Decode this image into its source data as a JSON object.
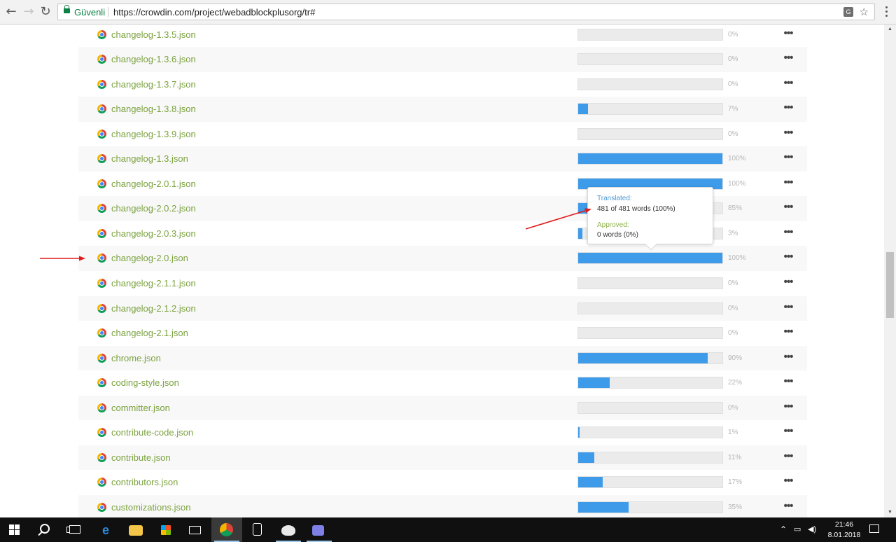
{
  "browser": {
    "secure_label": "Güvenli",
    "url": "https://crowdin.com/project/webadblockplusorg/tr#"
  },
  "files": [
    {
      "name": "changelog-1.3.5.json",
      "percent": 0,
      "percent_label": "0%"
    },
    {
      "name": "changelog-1.3.6.json",
      "percent": 0,
      "percent_label": "0%"
    },
    {
      "name": "changelog-1.3.7.json",
      "percent": 0,
      "percent_label": "0%"
    },
    {
      "name": "changelog-1.3.8.json",
      "percent": 7,
      "percent_label": "7%"
    },
    {
      "name": "changelog-1.3.9.json",
      "percent": 0,
      "percent_label": "0%"
    },
    {
      "name": "changelog-1.3.json",
      "percent": 100,
      "percent_label": "100%"
    },
    {
      "name": "changelog-2.0.1.json",
      "percent": 100,
      "percent_label": "100%"
    },
    {
      "name": "changelog-2.0.2.json",
      "percent": 85,
      "percent_label": "85%"
    },
    {
      "name": "changelog-2.0.3.json",
      "percent": 3,
      "percent_label": "3%"
    },
    {
      "name": "changelog-2.0.json",
      "percent": 100,
      "percent_label": "100%"
    },
    {
      "name": "changelog-2.1.1.json",
      "percent": 0,
      "percent_label": "0%"
    },
    {
      "name": "changelog-2.1.2.json",
      "percent": 0,
      "percent_label": "0%"
    },
    {
      "name": "changelog-2.1.json",
      "percent": 0,
      "percent_label": "0%"
    },
    {
      "name": "chrome.json",
      "percent": 90,
      "percent_label": "90%"
    },
    {
      "name": "coding-style.json",
      "percent": 22,
      "percent_label": "22%"
    },
    {
      "name": "committer.json",
      "percent": 0,
      "percent_label": "0%"
    },
    {
      "name": "contribute-code.json",
      "percent": 1,
      "percent_label": "1%"
    },
    {
      "name": "contribute.json",
      "percent": 11,
      "percent_label": "11%"
    },
    {
      "name": "contributors.json",
      "percent": 17,
      "percent_label": "17%"
    },
    {
      "name": "customizations.json",
      "percent": 35,
      "percent_label": "35%"
    }
  ],
  "tooltip": {
    "translated_label": "Translated:",
    "translated_value": "481 of 481 words (100%)",
    "approved_label": "Approved:",
    "approved_value": "0 words (0%)"
  },
  "taskbar": {
    "time": "21:46",
    "date": "8.01.2018"
  },
  "colors": {
    "progress": "#3d9be9",
    "file_link": "#7ba23f",
    "annotation_arrow": "#e21b1b"
  }
}
